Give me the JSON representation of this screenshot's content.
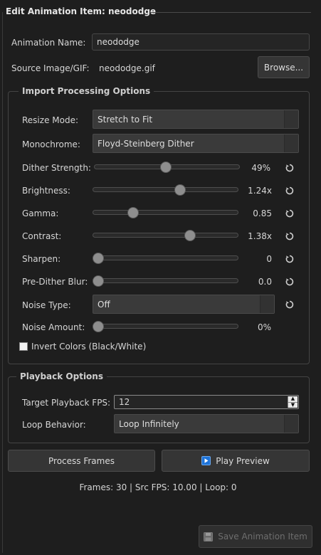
{
  "window": {
    "title": "Edit Animation Item: neododge"
  },
  "form": {
    "name_label": "Animation Name:",
    "name_value": "neododge",
    "source_label": "Source Image/GIF:",
    "source_value": "neododge.gif",
    "browse_label": "Browse..."
  },
  "import_group": {
    "title": "Import  Processing Options",
    "resize_label": "Resize Mode:",
    "resize_value": "Stretch to Fit",
    "mono_label": "Monochrome:",
    "mono_value": "Floyd-Steinberg Dither",
    "sliders": [
      {
        "label": "Dither Strength:",
        "value_text": "49%",
        "level": 0.49,
        "reset": true
      },
      {
        "label": "Brightness:",
        "value_text": "1.24x",
        "level": 0.61,
        "reset": true
      },
      {
        "label": "Gamma:",
        "value_text": "0.85",
        "level": 0.26,
        "reset": true
      },
      {
        "label": "Contrast:",
        "value_text": "1.38x",
        "level": 0.68,
        "reset": true
      },
      {
        "label": "Sharpen:",
        "value_text": "0",
        "level": 0.0,
        "reset": true
      },
      {
        "label": "Pre-Dither Blur:",
        "value_text": "0.0",
        "level": 0.0,
        "reset": true
      }
    ],
    "noise_type_label": "Noise Type:",
    "noise_type_value": "Off",
    "noise_amount_label": "Noise Amount:",
    "noise_amount_value": "0%",
    "noise_amount_level": 0.0,
    "invert_label": "Invert Colors (Black/White)",
    "invert_checked": false
  },
  "playback_group": {
    "title": "Playback Options",
    "fps_label": "Target Playback FPS:",
    "fps_value": "12",
    "loop_label": "Loop Behavior:",
    "loop_value": "Loop Infinitely"
  },
  "actions": {
    "process_label": "Process Frames",
    "preview_label": "Play Preview"
  },
  "status": {
    "text": "Frames: 30 | Src FPS: 10.00 | Loop: 0"
  },
  "footer": {
    "save_label": "Save Animation Item"
  },
  "colors": {
    "accent": "#1e73d8",
    "background": "#1e1e1e"
  }
}
